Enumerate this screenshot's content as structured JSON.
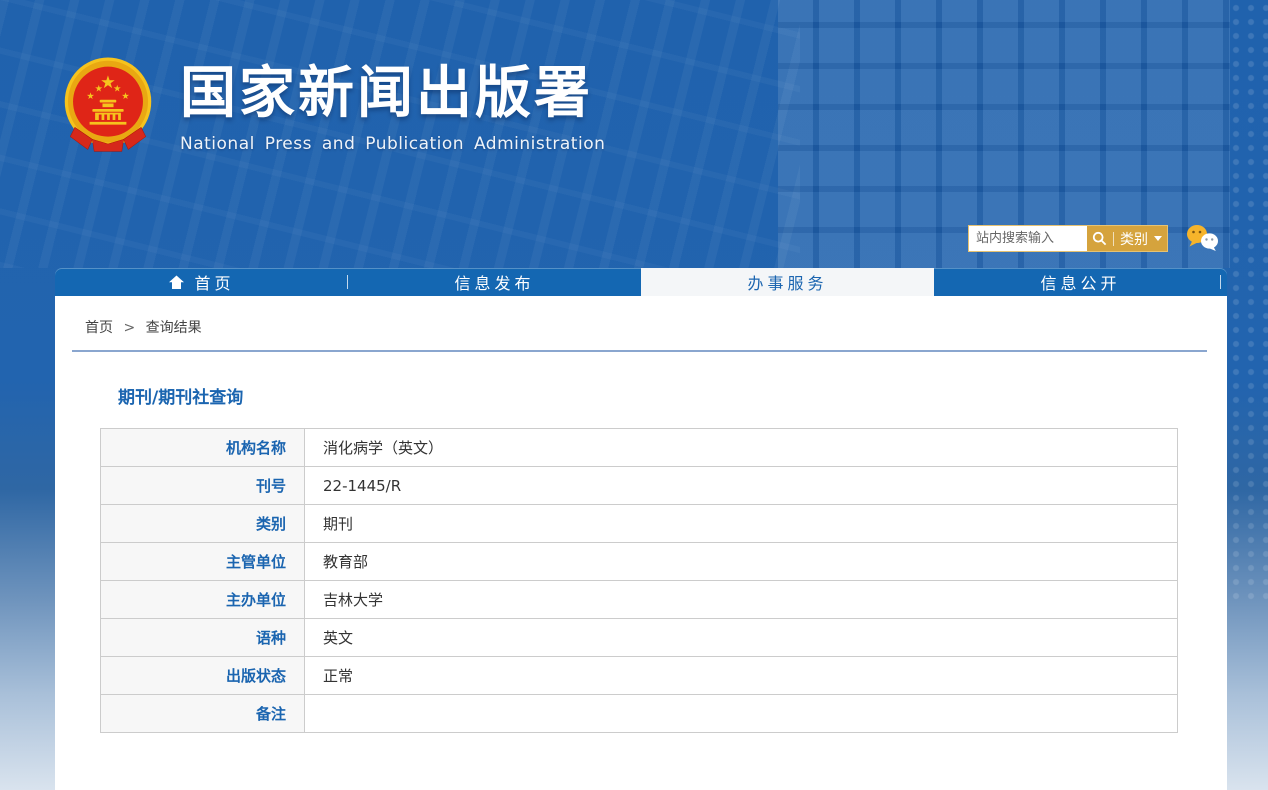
{
  "header": {
    "site_title": "国家新闻出版署",
    "site_subtitle": "National  Press and Publication Administration",
    "emblem_icon": "national-emblem"
  },
  "search": {
    "placeholder": "站内搜索输入",
    "search_icon": "magnifier-icon",
    "category_label": "类别",
    "caret_icon": "chevron-down-icon",
    "wechat_icon": "wechat-icon"
  },
  "nav": {
    "items": [
      {
        "label": "首页",
        "icon": "home-icon",
        "active": false
      },
      {
        "label": "信息发布",
        "active": false
      },
      {
        "label": "办事服务",
        "active": true
      },
      {
        "label": "信息公开",
        "active": false
      }
    ]
  },
  "breadcrumb": {
    "home": "首页",
    "separator": ">",
    "current": "查询结果"
  },
  "main": {
    "title": "期刊/期刊社查询",
    "table": {
      "rows": [
        {
          "label": "机构名称",
          "value": "消化病学（英文）"
        },
        {
          "label": "刊号",
          "value": "22-1445/R"
        },
        {
          "label": "类别",
          "value": "期刊"
        },
        {
          "label": "主管单位",
          "value": "教育部"
        },
        {
          "label": "主办单位",
          "value": "吉林大学"
        },
        {
          "label": "语种",
          "value": "英文"
        },
        {
          "label": "出版状态",
          "value": "正常"
        },
        {
          "label": "备注",
          "value": ""
        }
      ]
    }
  },
  "colors": {
    "header_blue": "#2264af",
    "nav_blue": "#1467b2",
    "accent_blue": "#1b65b0",
    "gold": "#d5a33d",
    "active_tab": "#f4f6f8",
    "table_border": "#cccccc",
    "label_bg": "#f7f7f7"
  }
}
